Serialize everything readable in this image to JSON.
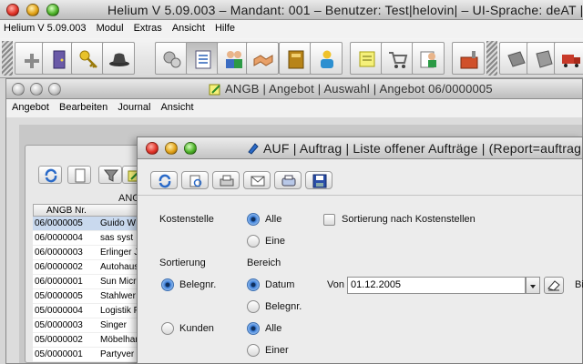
{
  "main_window": {
    "title": "Helium V 5.09.003 – Mandant: 001 – Benutzer: Test|helovin| – UI-Sprache: deAT |",
    "menu": [
      "Helium V 5.09.003",
      "Modul",
      "Extras",
      "Ansicht",
      "Hilfe"
    ],
    "toolbar_icons": [
      "angebot-plus-icon",
      "door-exit-icon",
      "key-icon",
      "hat-icon",
      "gears-icon",
      "list-icon",
      "users-icon",
      "handshake-icon",
      "book-icon",
      "person-icon",
      "notes-icon",
      "cart-icon",
      "person-document-icon",
      "factory-icon",
      "delivery-note-icon",
      "invoice-icon",
      "truck-icon"
    ]
  },
  "angb_window": {
    "title": "ANGB | Angebot | Auswahl | Angebot 06/0000005",
    "menu": [
      "Angebot",
      "Bearbeiten",
      "Journal",
      "Ansicht"
    ],
    "panel_label": "ANGE",
    "table": {
      "header": "ANGB Nr.",
      "rows": [
        {
          "nr": "06/0000005",
          "name": "Guido W"
        },
        {
          "nr": "06/0000004",
          "name": "sas syst"
        },
        {
          "nr": "06/0000003",
          "name": "Erlinger J"
        },
        {
          "nr": "06/0000002",
          "name": "Autohaus"
        },
        {
          "nr": "06/0000001",
          "name": "Sun Micr"
        },
        {
          "nr": "05/0000005",
          "name": "Stahlwer"
        },
        {
          "nr": "05/0000004",
          "name": "Logistik F"
        },
        {
          "nr": "05/0000003",
          "name": "Singer"
        },
        {
          "nr": "05/0000002",
          "name": "Möbelhan"
        },
        {
          "nr": "05/0000001",
          "name": "Partyver"
        }
      ]
    }
  },
  "auf_window": {
    "title": "AUF | Auftrag | Liste offener Aufträge | (Report=auftrag",
    "form": {
      "kostenstelle_label": "Kostenstelle",
      "alle_label": "Alle",
      "eine_label": "Eine",
      "sortierung_kst_label": "Sortierung nach Kostenstellen",
      "sortierung_label": "Sortierung",
      "bereich_label": "Bereich",
      "belegnr_label": "Belegnr.",
      "datum_label": "Datum",
      "belegnr2_label": "Belegnr.",
      "kunden_label": "Kunden",
      "alle2_label": "Alle",
      "einer_label": "Einer",
      "von_label": "Von",
      "von_value": "01.12.2005",
      "bis_label": "Bi"
    }
  }
}
